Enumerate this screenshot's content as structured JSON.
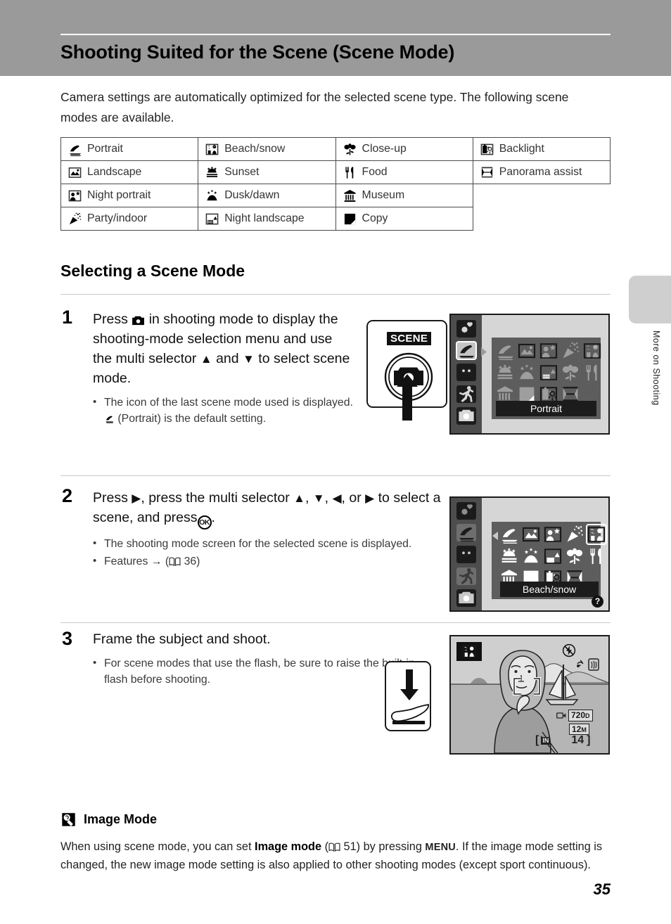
{
  "header": {
    "title": "Shooting Suited for the Scene (Scene Mode)"
  },
  "intro": "Camera settings are automatically optimized for the selected scene type. The following scene modes are available.",
  "scene_table": {
    "rows": [
      [
        {
          "icon": "portrait-icon",
          "label": "Portrait"
        },
        {
          "icon": "beach-snow-icon",
          "label": "Beach/snow"
        },
        {
          "icon": "close-up-icon",
          "label": "Close-up"
        },
        {
          "icon": "backlight-icon",
          "label": "Backlight"
        }
      ],
      [
        {
          "icon": "landscape-icon",
          "label": "Landscape"
        },
        {
          "icon": "sunset-icon",
          "label": "Sunset"
        },
        {
          "icon": "food-icon",
          "label": "Food"
        },
        {
          "icon": "panorama-assist-icon",
          "label": "Panorama assist"
        }
      ],
      [
        {
          "icon": "night-portrait-icon",
          "label": "Night portrait"
        },
        {
          "icon": "dusk-dawn-icon",
          "label": "Dusk/dawn"
        },
        {
          "icon": "museum-icon",
          "label": "Museum"
        },
        {
          "icon": "",
          "label": ""
        }
      ],
      [
        {
          "icon": "party-indoor-icon",
          "label": "Party/indoor"
        },
        {
          "icon": "night-landscape-icon",
          "label": "Night landscape"
        },
        {
          "icon": "copy-icon",
          "label": "Copy"
        },
        {
          "icon": "",
          "label": ""
        }
      ]
    ]
  },
  "section": {
    "heading": "Selecting a Scene Mode"
  },
  "steps": [
    {
      "number": "1",
      "text_a": "Press",
      "text_b": "in shooting mode to display the shooting-mode selection menu and use the multi selector",
      "text_c": "and",
      "text_d": "to select scene mode.",
      "bullet_a": "The icon of the last scene mode used is displayed.",
      "bullet_b": "(Portrait) is the default setting."
    },
    {
      "number": "2",
      "text_a": "Press",
      "text_b": ", press the multi selector",
      "text_c": "to select a scene, and press",
      "text_d": ".",
      "bullets": [
        "The shooting mode screen for the selected scene is displayed.",
        "Features"
      ],
      "feature_ref": "36",
      "feature_arrow": "→"
    },
    {
      "number": "3",
      "text_a": "Frame the subject and shoot.",
      "bullets": [
        "For scene modes that use the flash, be sure to raise the built-in flash before shooting."
      ]
    }
  ],
  "figures": {
    "scene_button": {
      "label": "SCENE",
      "icon": "camera-shutter-button-icon",
      "arrow": "press-up-arrow-icon"
    },
    "lcd1": {
      "caption": "Portrait",
      "mode_icons": [
        "auto-scene-heart-icon",
        "scene-portrait-icon",
        "smile-icon",
        "sport-icon",
        "auto-camera-icon"
      ],
      "selected_mode_index": 1,
      "grid_icons": [
        "portrait-icon",
        "landscape-icon",
        "night-portrait-icon",
        "party-indoor-icon",
        "beach-snow-icon",
        "sunset-icon",
        "dusk-dawn-icon",
        "night-landscape-icon",
        "close-up-icon",
        "food-icon",
        "museum-icon",
        "copy-icon",
        "backlight-icon",
        "panorama-assist-icon"
      ],
      "selected_grid_index": -1
    },
    "lcd2": {
      "caption": "Beach/snow",
      "mode_icons": [
        "auto-scene-heart-icon",
        "scene-portrait-icon",
        "smile-icon",
        "sport-icon",
        "auto-camera-icon"
      ],
      "selected_mode_index": 1,
      "grid_icons": [
        "portrait-icon",
        "landscape-icon",
        "night-portrait-icon",
        "party-indoor-icon",
        "beach-snow-icon",
        "sunset-icon",
        "dusk-dawn-icon",
        "night-landscape-icon",
        "close-up-icon",
        "food-icon",
        "museum-icon",
        "copy-icon",
        "backlight-icon",
        "panorama-assist-icon"
      ],
      "selected_grid_index": 4,
      "help_badge": "?"
    },
    "flash_figure": {
      "arrow": "down-arrow-icon",
      "hand": "hand-icon"
    },
    "preview": {
      "scene_badge": "beach-snow-icon",
      "flash_off_indicator": "flash-off-icon",
      "vr_indicator": "vibration-reduction-icon",
      "movie_size": "720",
      "movie_size_sub": "D",
      "image_size": "12",
      "image_size_sub": "M",
      "memory_icon": "internal-memory-icon",
      "shots_remaining": "14"
    }
  },
  "side_tab": {
    "text": "More on Shooting"
  },
  "note": {
    "icon": "tip-bulb-icon",
    "title": "Image Mode",
    "text_a": "When using scene mode, you can set",
    "bold_a": "Image mode",
    "ref": "51",
    "text_b": ") by pressing",
    "menu": "MENU",
    "text_c": ". If the image mode setting is changed, the new image mode setting is also applied to other shooting modes (except sport continuous)."
  },
  "page_number": "35",
  "colors": {
    "header_band": "#9a9a9a",
    "lcd_background": "#d6d6d6",
    "lcd_sidebar": "#4d4d4d",
    "lcd_panel": "#5d5d5d",
    "caption_bar": "#1c1c1c",
    "side_tab": "#cfcfcf"
  }
}
